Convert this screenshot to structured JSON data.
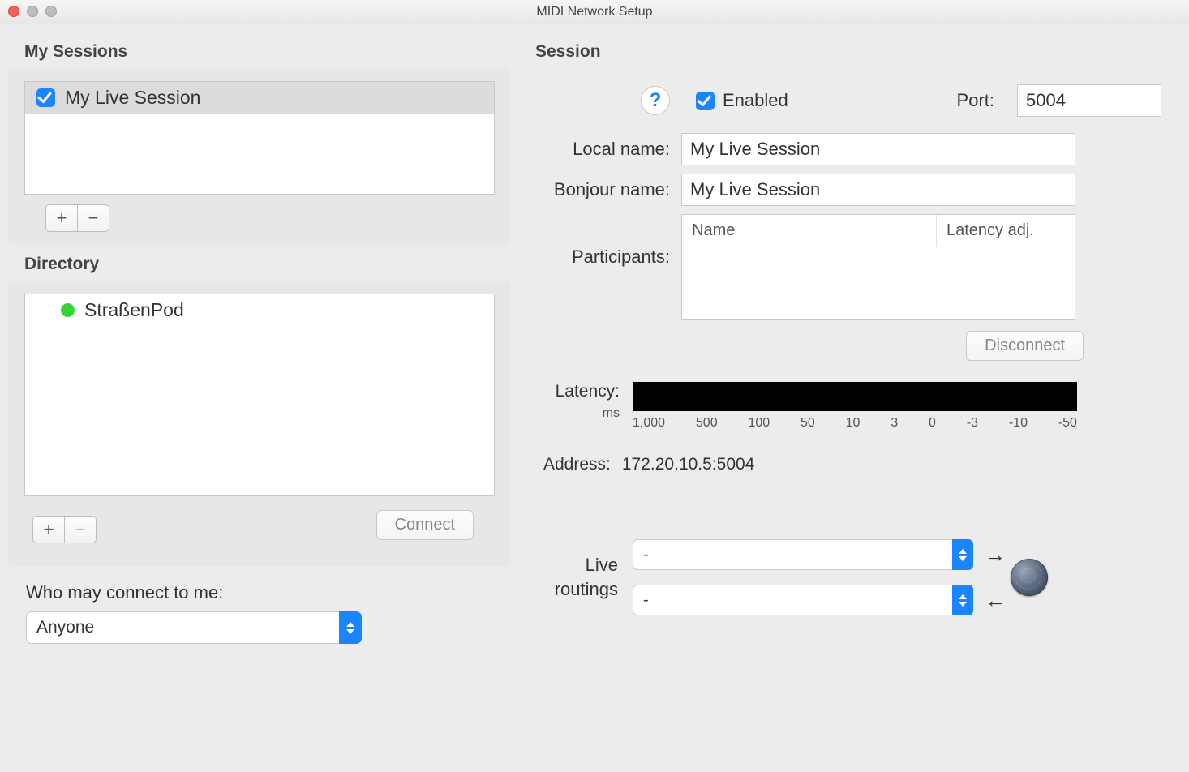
{
  "window": {
    "title": "MIDI Network Setup"
  },
  "left": {
    "sessions_header": "My Sessions",
    "sessions": [
      {
        "checked": true,
        "name": "My Live Session"
      }
    ],
    "add_label": "+",
    "remove_label": "−",
    "directory_header": "Directory",
    "directory": [
      {
        "online": true,
        "name": "StraßenPod"
      }
    ],
    "connect_label": "Connect",
    "who_label": "Who may connect to me:",
    "who_value": "Anyone"
  },
  "right": {
    "header": "Session",
    "help": "?",
    "enabled_label": "Enabled",
    "enabled": true,
    "port_label": "Port:",
    "port_value": "5004",
    "local_name_label": "Local name:",
    "local_name_value": "My Live Session",
    "bonjour_label": "Bonjour name:",
    "bonjour_value": "My Live Session",
    "participants_label": "Participants:",
    "participants_cols": {
      "name": "Name",
      "latency": "Latency adj."
    },
    "disconnect_label": "Disconnect",
    "latency_label": "Latency:",
    "latency_unit": "ms",
    "latency_ticks": [
      "1.000",
      "500",
      "100",
      "50",
      "10",
      "3",
      "0",
      "-3",
      "-10",
      "-50"
    ],
    "address_label": "Address:",
    "address_value": "172.20.10.5:5004",
    "routings_label_l1": "Live",
    "routings_label_l2": "routings",
    "routing_out_value": "-",
    "routing_in_value": "-"
  }
}
